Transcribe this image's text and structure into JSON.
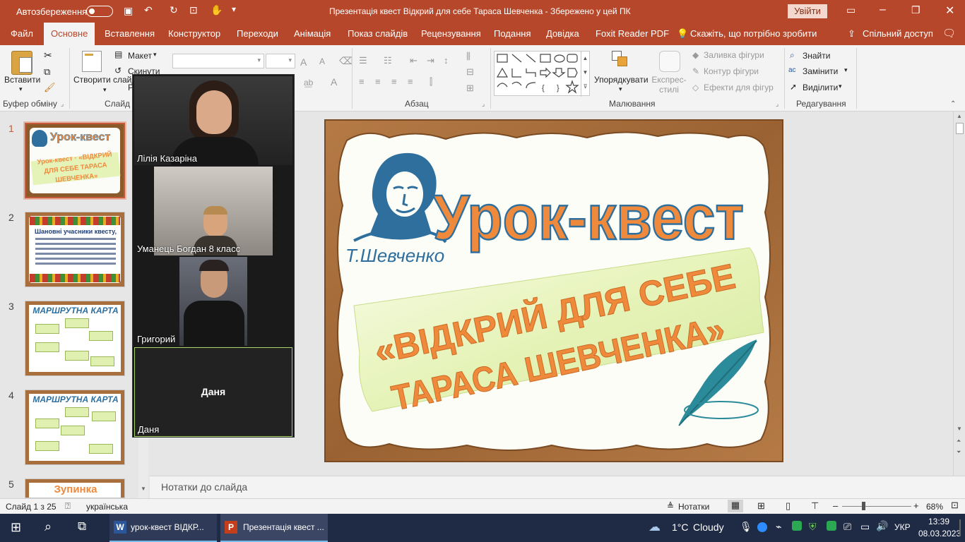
{
  "titlebar": {
    "autosave_label": "Автозбереження",
    "autosave_state": "Вимк.",
    "document_title": "Презентація квест Відкрий для себе Тараса Шевченка  -  Збережено у цей ПК",
    "signin_button": "Увійти"
  },
  "tabs": [
    "Файл",
    "Основне",
    "Вставлення",
    "Конструктор",
    "Переходи",
    "Анімація",
    "Показ слайдів",
    "Рецензування",
    "Подання",
    "Довідка",
    "Foxit Reader PDF"
  ],
  "tell_me": "Скажіть, що потрібно зробити",
  "share": "Спільний доступ",
  "ribbon": {
    "paste": "Вставити",
    "clipboard": "Буфер обміну",
    "new_slide": "Створити слайд",
    "layout": "Макет",
    "reset": "Скинути",
    "section_partial": "Р",
    "slides_group_partial": "Слайд",
    "paragraph": "Абзац",
    "arrange": "Упорядкувати",
    "quick_styles": "Експрес-стилі",
    "shape_fill": "Заливка фігури",
    "shape_outline": "Контур фігури",
    "shape_effects": "Ефекти для фігур",
    "drawing": "Малювання",
    "find": "Знайти",
    "replace": "Замінити",
    "select": "Виділити",
    "editing": "Редагування"
  },
  "thumbnails": [
    {
      "num": "1",
      "text": "Урок-квест · «ВІДКРИЙ ДЛЯ СЕБЕ ТАРАСА ШЕВЧЕНКА»"
    },
    {
      "num": "2",
      "text": "Шановні учасники квесту,"
    },
    {
      "num": "3",
      "text": "МАРШРУТНА КАРТА"
    },
    {
      "num": "4",
      "text": "МАРШРУТНА КАРТА"
    },
    {
      "num": "5",
      "text": "Зупинка"
    }
  ],
  "slide": {
    "title": "Урок-квест",
    "signature": "Т.Шевченко",
    "line1": "«ВІДКРИЙ ДЛЯ СЕБЕ",
    "line2": "ТАРАСА ШЕВЧЕНКА»"
  },
  "video_call": {
    "participants": [
      {
        "name": "Лілія Казаріна"
      },
      {
        "name": "Уманець Богдан 8 класс"
      },
      {
        "name": "Григорий"
      },
      {
        "name": "Даня",
        "center_label": "Даня"
      }
    ]
  },
  "notes_placeholder": "Нотатки до слайда",
  "status": {
    "slide_info": "Слайд 1 з 25",
    "language": "українська",
    "notes_button": "Нотатки",
    "zoom": "68%"
  },
  "taskbar": {
    "apps": [
      {
        "label": "урок-квест ВІДКР..."
      },
      {
        "label": "Презентація квест ..."
      }
    ],
    "weather_temp": "1°C",
    "weather_text": "Cloudy",
    "lang": "УКР",
    "time": "13:39",
    "date": "08.03.2023"
  },
  "colors": {
    "accent": "#b7472a",
    "slide_orange": "#ef8a3c",
    "slide_blue": "#2e6f9e"
  }
}
